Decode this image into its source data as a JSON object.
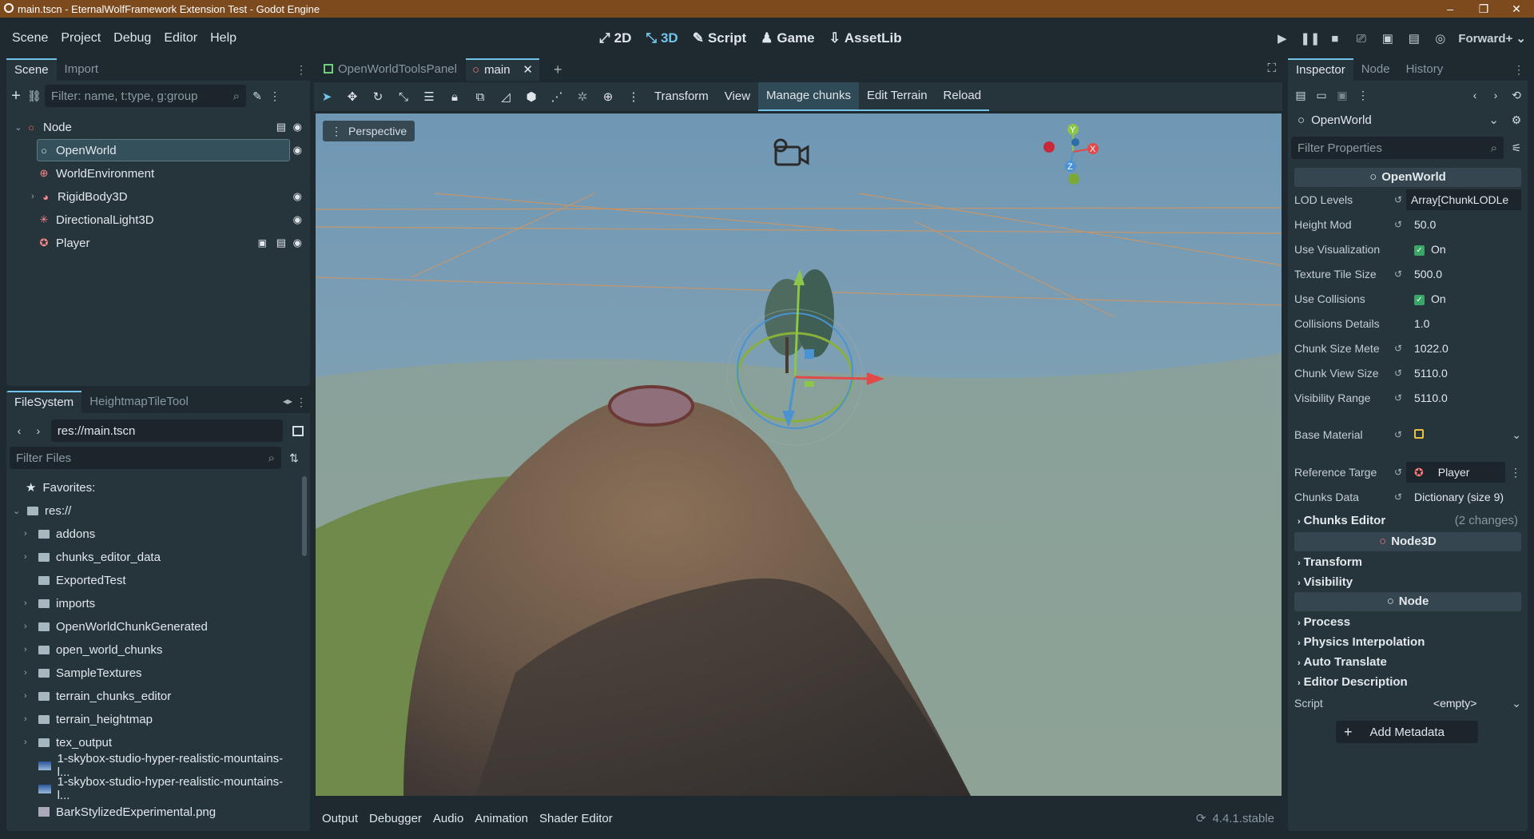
{
  "window": {
    "title": "main.tscn - EternalWolfFramework Extension Test - Godot Engine",
    "controls": [
      "–",
      "❐",
      "✕"
    ]
  },
  "menu": [
    "Scene",
    "Project",
    "Debug",
    "Editor",
    "Help"
  ],
  "main_screens": [
    {
      "label": "2D",
      "icon": "2d-icon"
    },
    {
      "label": "3D",
      "icon": "3d-icon",
      "active": true
    },
    {
      "label": "Script",
      "icon": "script-icon"
    },
    {
      "label": "Game",
      "icon": "game-icon"
    },
    {
      "label": "AssetLib",
      "icon": "assetlib-icon"
    }
  ],
  "renderer": "Forward+",
  "scene_panel": {
    "tabs": [
      "Scene",
      "Import"
    ],
    "filter_placeholder": "Filter: name, t:type, g:group",
    "nodes": [
      {
        "name": "Node",
        "icon_color": "#ff5f5f"
      },
      {
        "name": "OpenWorld",
        "icon_color": "#ff5f5f",
        "selected": true
      },
      {
        "name": "WorldEnvironment",
        "icon_color": "#ff7a7a"
      },
      {
        "name": "RigidBody3D",
        "icon_color": "#ff7a7a"
      },
      {
        "name": "DirectionalLight3D",
        "icon_color": "#ff7a7a"
      },
      {
        "name": "Player",
        "icon_color": "#ff7a7a"
      }
    ]
  },
  "filesystem": {
    "tabs": [
      "FileSystem",
      "HeightmapTileTool"
    ],
    "path": "res://main.tscn",
    "filter_placeholder": "Filter Files",
    "favorites": "Favorites:",
    "root": "res://",
    "items": [
      "addons",
      "chunks_editor_data",
      "ExportedTest",
      "imports",
      "OpenWorldChunkGenerated",
      "open_world_chunks",
      "SampleTextures",
      "terrain_chunks_editor",
      "terrain_heightmap",
      "tex_output"
    ],
    "files": [
      "1-skybox-studio-hyper-realistic-mountains-l...",
      "1-skybox-studio-hyper-realistic-mountains-l...",
      "BarkStylizedExperimental.png"
    ]
  },
  "editor_tabs": [
    {
      "label": "OpenWorldToolsPanel"
    },
    {
      "label": "main",
      "active": true
    }
  ],
  "viewport_toolbar": {
    "items": [
      "Transform",
      "View",
      "Manage chunks",
      "Edit Terrain",
      "Reload"
    ],
    "active": "Manage chunks"
  },
  "viewport": {
    "perspective_label": "Perspective",
    "gizmo_axes": [
      "Y",
      "X",
      "Z"
    ]
  },
  "inspector": {
    "tabs": [
      "Inspector",
      "Node",
      "History"
    ],
    "object": "OpenWorld",
    "filter_placeholder": "Filter Properties",
    "class_header": "OpenWorld",
    "properties": [
      {
        "label": "LOD Levels",
        "value": "Array[ChunkLODLe"
      },
      {
        "label": "Height Mod",
        "value": "50.0"
      },
      {
        "label": "Use Visualization",
        "value": "On"
      },
      {
        "label": "Texture Tile Size",
        "value": "500.0"
      },
      {
        "label": "Use Collisions",
        "value": "On"
      },
      {
        "label": "Collisions Details",
        "value": "1.0"
      },
      {
        "label": "Chunk Size Mete",
        "value": "1022.0"
      },
      {
        "label": "Chunk View Size",
        "value": "5110.0"
      },
      {
        "label": "Visibility Range",
        "value": "5110.0"
      },
      {
        "label": "Base Material",
        "value": ""
      },
      {
        "label": "Reference Targe",
        "value": "Player"
      },
      {
        "label": "Chunks Data",
        "value": "Dictionary (size 9)"
      }
    ],
    "chunks_editor": {
      "label": "Chunks Editor",
      "note": "(2 changes)"
    },
    "node3d_header": "Node3D",
    "node3d_groups": [
      "Transform",
      "Visibility"
    ],
    "node_header": "Node",
    "node_groups": [
      "Process",
      "Physics Interpolation",
      "Auto Translate",
      "Editor Description"
    ],
    "script": {
      "label": "Script",
      "value": "<empty>"
    },
    "add_metadata": "Add Metadata"
  },
  "bottom_panel": {
    "tabs": [
      "Output",
      "Debugger",
      "Audio",
      "Animation",
      "Shader Editor"
    ],
    "version": "4.4.1.stable"
  }
}
